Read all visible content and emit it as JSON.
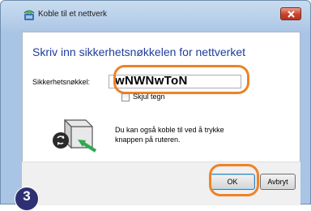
{
  "window": {
    "title": "Koble til et nettverk"
  },
  "main": {
    "heading": "Skriv inn sikkerhetsnøkkelen for nettverket",
    "key_label": "Sikkerhetsnøkkel:",
    "key_value": "wNWNwToN",
    "hide_chars_label": "Skjul tegn",
    "hide_chars_checked": false,
    "info_text": "Du kan også koble til ved å trykke knappen på ruteren."
  },
  "footer": {
    "ok_label": "OK",
    "cancel_label": "Avbryt"
  },
  "annotation": {
    "step_number": "3",
    "highlight_color": "#ee8228",
    "badge_color": "#2f2f73"
  },
  "icons": {
    "app": "wifi-network-icon",
    "close": "close-icon",
    "router": "router-push-button-icon"
  }
}
